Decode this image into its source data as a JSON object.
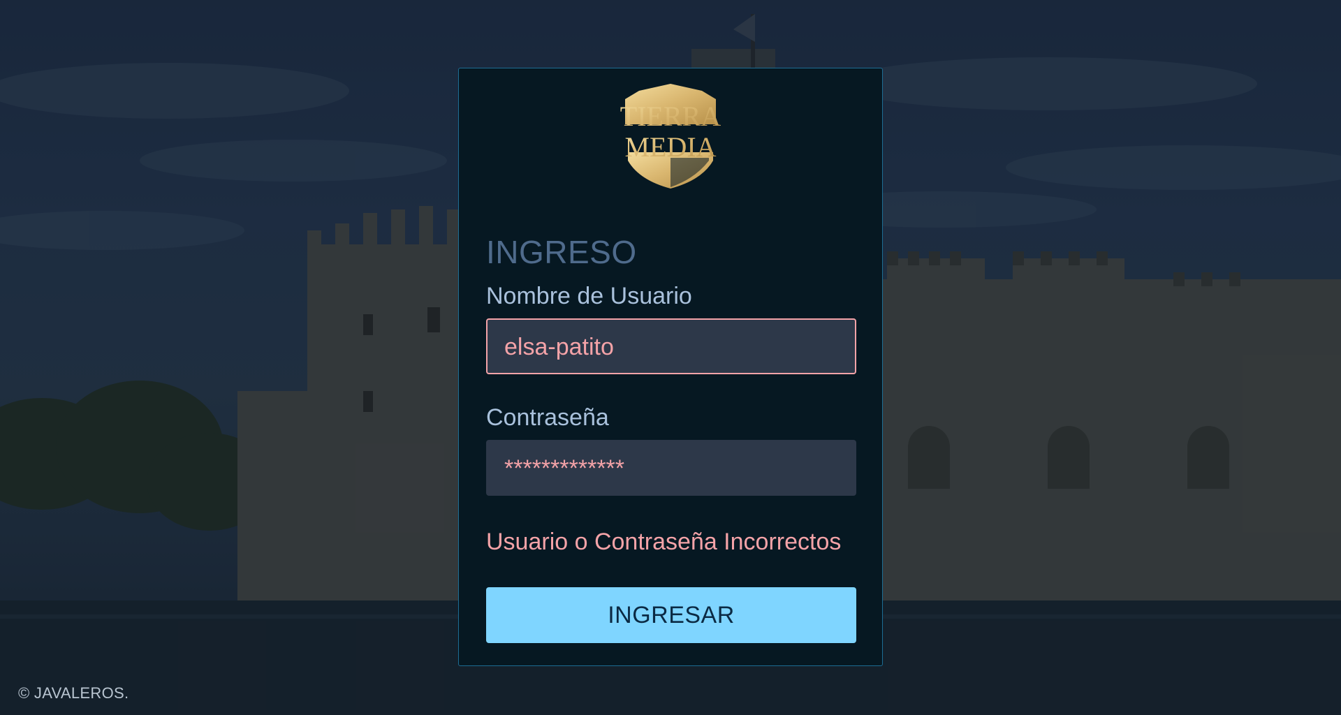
{
  "brand": {
    "logo_line1": "TIERRA",
    "logo_line2": "MEDIA"
  },
  "login": {
    "heading": "INGRESO",
    "username_label": "Nombre de Usuario",
    "username_value": "elsa-patito",
    "password_label": "Contraseña",
    "password_value": "*************",
    "error_message": "Usuario o Contraseña Incorrectos",
    "submit_label": "INGRESAR"
  },
  "footer": {
    "copyright": "© JAVALEROS."
  },
  "colors": {
    "card_bg": "#061822",
    "card_border": "#1d6d94",
    "heading": "#4f6b8c",
    "label": "#a9c1dc",
    "field_bg": "#2d3849",
    "error": "#f4a3a8",
    "button_bg": "#7fd5ff",
    "button_text": "#0b2a44",
    "logo_gold": "#d9b66f"
  },
  "icons": {
    "logo": "shield-crest-icon"
  }
}
